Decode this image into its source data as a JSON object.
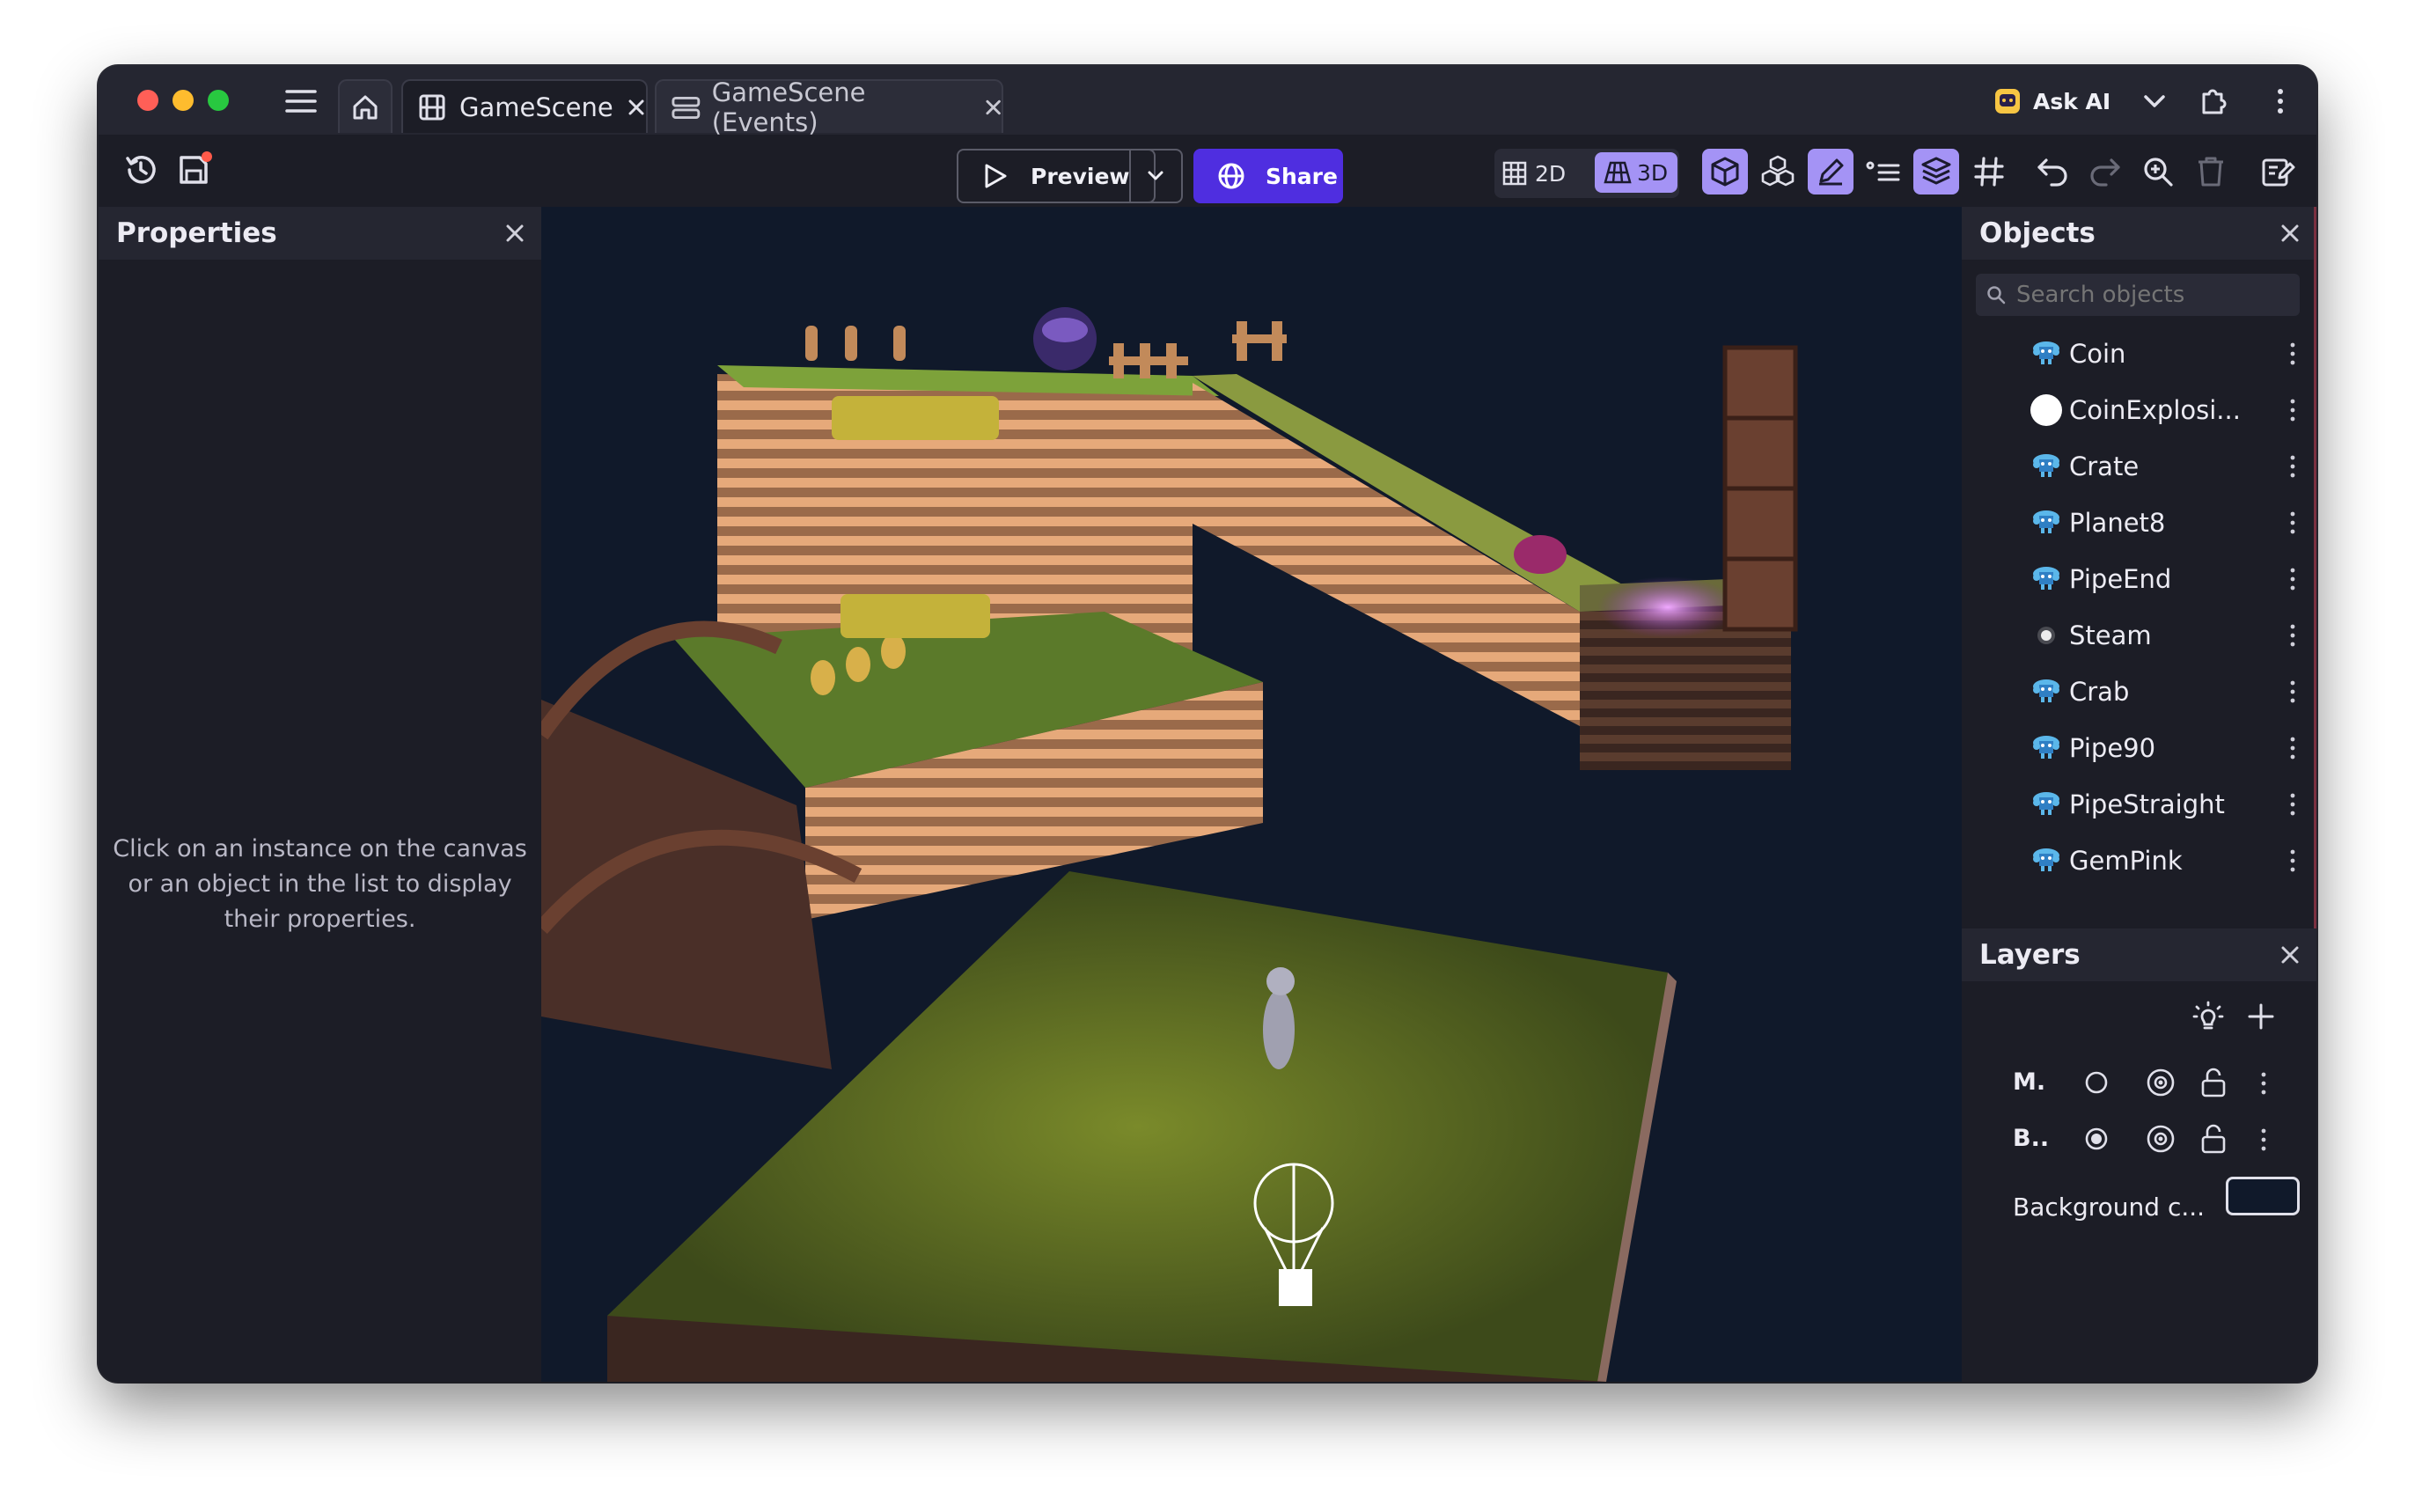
{
  "window": {
    "tabs": [
      {
        "label": "GameScene",
        "active": true
      },
      {
        "label": "GameScene (Events)",
        "active": false
      }
    ],
    "ask_ai_label": "Ask AI"
  },
  "toolbar": {
    "preview_label": "Preview",
    "share_label": "Share",
    "view_2d_label": "2D",
    "view_3d_label": "3D",
    "accent_color": "#4f2ee0"
  },
  "properties": {
    "title": "Properties",
    "empty_message_line1": "Click on an instance on the canvas",
    "empty_message_line2": "or an object in the list to display",
    "empty_message_line3": "their properties."
  },
  "objects": {
    "title": "Objects",
    "search_placeholder": "Search objects",
    "items": [
      {
        "name": "Coin",
        "icon": "3d-model-icon"
      },
      {
        "name": "CoinExplosi...",
        "icon": "white-circle-icon"
      },
      {
        "name": "Crate",
        "icon": "3d-model-icon"
      },
      {
        "name": "Planet8",
        "icon": "3d-model-icon"
      },
      {
        "name": "PipeEnd",
        "icon": "3d-model-icon"
      },
      {
        "name": "Steam",
        "icon": "particle-icon"
      },
      {
        "name": "Crab",
        "icon": "3d-model-icon"
      },
      {
        "name": "Pipe90",
        "icon": "3d-model-icon"
      },
      {
        "name": "PipeStraight",
        "icon": "3d-model-icon"
      },
      {
        "name": "GemPink",
        "icon": "3d-model-icon"
      }
    ]
  },
  "layers": {
    "title": "Layers",
    "items": [
      {
        "name": "M.",
        "selected": false
      },
      {
        "name": "B..",
        "selected": true
      }
    ],
    "background_label": "Background c..."
  }
}
